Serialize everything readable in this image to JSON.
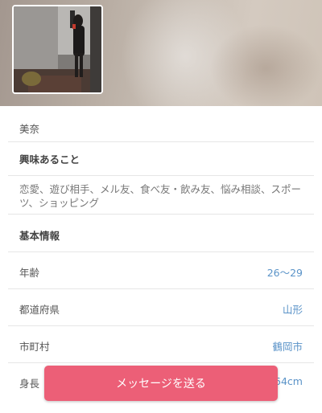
{
  "profile": {
    "name": "美奈"
  },
  "interests": {
    "heading": "興味あること",
    "text": "恋愛、遊び相手、メル友、食べ友・飲み友、悩み相談、スポーツ、ショッピング"
  },
  "basic_info": {
    "heading": "基本情報",
    "rows": [
      {
        "label": "年齢",
        "value": "26～29"
      },
      {
        "label": "都道府県",
        "value": "山形"
      },
      {
        "label": "市町村",
        "value": "鶴岡市"
      },
      {
        "label": "身長",
        "value": "64cm"
      }
    ]
  },
  "cta": {
    "label": "メッセージを送る"
  },
  "colors": {
    "accent": "#ec5f77",
    "link": "#5a93c8"
  }
}
